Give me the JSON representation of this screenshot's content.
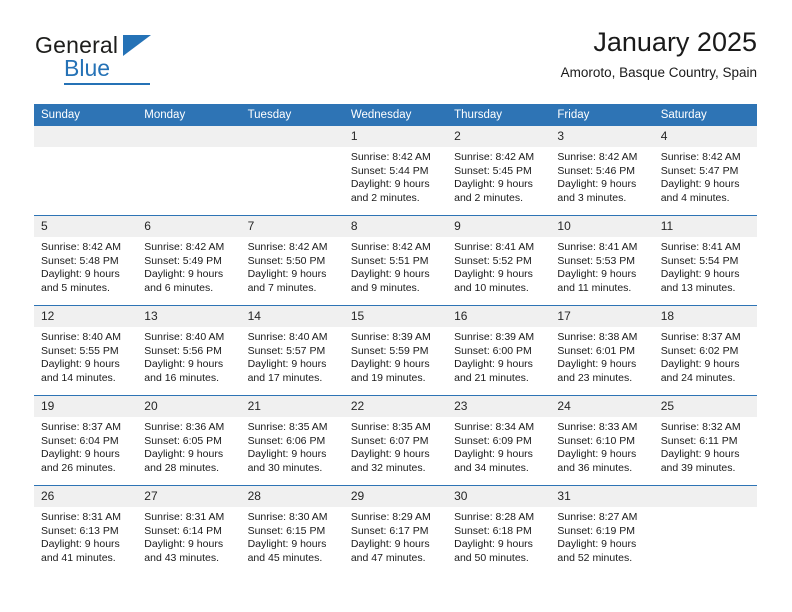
{
  "brand": {
    "name_primary": "General",
    "name_secondary": "Blue",
    "triangle_icon": "triangle-icon",
    "accent_color": "#2572b6"
  },
  "header": {
    "title": "January 2025",
    "subtitle": "Amoroto, Basque Country, Spain"
  },
  "colors": {
    "header_blue": "#2e74b5",
    "daynum_gray": "#f0f0f0",
    "text": "#1a1a1a"
  },
  "calendar": {
    "weekday_headers": [
      "Sunday",
      "Monday",
      "Tuesday",
      "Wednesday",
      "Thursday",
      "Friday",
      "Saturday"
    ],
    "weeks": [
      [
        {
          "day": "",
          "empty": true,
          "sunrise": "",
          "sunset": "",
          "daylight_line1": "",
          "daylight_line2": ""
        },
        {
          "day": "",
          "empty": true,
          "sunrise": "",
          "sunset": "",
          "daylight_line1": "",
          "daylight_line2": ""
        },
        {
          "day": "",
          "empty": true,
          "sunrise": "",
          "sunset": "",
          "daylight_line1": "",
          "daylight_line2": ""
        },
        {
          "day": "1",
          "empty": false,
          "sunrise": "Sunrise: 8:42 AM",
          "sunset": "Sunset: 5:44 PM",
          "daylight_line1": "Daylight: 9 hours",
          "daylight_line2": "and 2 minutes."
        },
        {
          "day": "2",
          "empty": false,
          "sunrise": "Sunrise: 8:42 AM",
          "sunset": "Sunset: 5:45 PM",
          "daylight_line1": "Daylight: 9 hours",
          "daylight_line2": "and 2 minutes."
        },
        {
          "day": "3",
          "empty": false,
          "sunrise": "Sunrise: 8:42 AM",
          "sunset": "Sunset: 5:46 PM",
          "daylight_line1": "Daylight: 9 hours",
          "daylight_line2": "and 3 minutes."
        },
        {
          "day": "4",
          "empty": false,
          "sunrise": "Sunrise: 8:42 AM",
          "sunset": "Sunset: 5:47 PM",
          "daylight_line1": "Daylight: 9 hours",
          "daylight_line2": "and 4 minutes."
        }
      ],
      [
        {
          "day": "5",
          "empty": false,
          "sunrise": "Sunrise: 8:42 AM",
          "sunset": "Sunset: 5:48 PM",
          "daylight_line1": "Daylight: 9 hours",
          "daylight_line2": "and 5 minutes."
        },
        {
          "day": "6",
          "empty": false,
          "sunrise": "Sunrise: 8:42 AM",
          "sunset": "Sunset: 5:49 PM",
          "daylight_line1": "Daylight: 9 hours",
          "daylight_line2": "and 6 minutes."
        },
        {
          "day": "7",
          "empty": false,
          "sunrise": "Sunrise: 8:42 AM",
          "sunset": "Sunset: 5:50 PM",
          "daylight_line1": "Daylight: 9 hours",
          "daylight_line2": "and 7 minutes."
        },
        {
          "day": "8",
          "empty": false,
          "sunrise": "Sunrise: 8:42 AM",
          "sunset": "Sunset: 5:51 PM",
          "daylight_line1": "Daylight: 9 hours",
          "daylight_line2": "and 9 minutes."
        },
        {
          "day": "9",
          "empty": false,
          "sunrise": "Sunrise: 8:41 AM",
          "sunset": "Sunset: 5:52 PM",
          "daylight_line1": "Daylight: 9 hours",
          "daylight_line2": "and 10 minutes."
        },
        {
          "day": "10",
          "empty": false,
          "sunrise": "Sunrise: 8:41 AM",
          "sunset": "Sunset: 5:53 PM",
          "daylight_line1": "Daylight: 9 hours",
          "daylight_line2": "and 11 minutes."
        },
        {
          "day": "11",
          "empty": false,
          "sunrise": "Sunrise: 8:41 AM",
          "sunset": "Sunset: 5:54 PM",
          "daylight_line1": "Daylight: 9 hours",
          "daylight_line2": "and 13 minutes."
        }
      ],
      [
        {
          "day": "12",
          "empty": false,
          "sunrise": "Sunrise: 8:40 AM",
          "sunset": "Sunset: 5:55 PM",
          "daylight_line1": "Daylight: 9 hours",
          "daylight_line2": "and 14 minutes."
        },
        {
          "day": "13",
          "empty": false,
          "sunrise": "Sunrise: 8:40 AM",
          "sunset": "Sunset: 5:56 PM",
          "daylight_line1": "Daylight: 9 hours",
          "daylight_line2": "and 16 minutes."
        },
        {
          "day": "14",
          "empty": false,
          "sunrise": "Sunrise: 8:40 AM",
          "sunset": "Sunset: 5:57 PM",
          "daylight_line1": "Daylight: 9 hours",
          "daylight_line2": "and 17 minutes."
        },
        {
          "day": "15",
          "empty": false,
          "sunrise": "Sunrise: 8:39 AM",
          "sunset": "Sunset: 5:59 PM",
          "daylight_line1": "Daylight: 9 hours",
          "daylight_line2": "and 19 minutes."
        },
        {
          "day": "16",
          "empty": false,
          "sunrise": "Sunrise: 8:39 AM",
          "sunset": "Sunset: 6:00 PM",
          "daylight_line1": "Daylight: 9 hours",
          "daylight_line2": "and 21 minutes."
        },
        {
          "day": "17",
          "empty": false,
          "sunrise": "Sunrise: 8:38 AM",
          "sunset": "Sunset: 6:01 PM",
          "daylight_line1": "Daylight: 9 hours",
          "daylight_line2": "and 23 minutes."
        },
        {
          "day": "18",
          "empty": false,
          "sunrise": "Sunrise: 8:37 AM",
          "sunset": "Sunset: 6:02 PM",
          "daylight_line1": "Daylight: 9 hours",
          "daylight_line2": "and 24 minutes."
        }
      ],
      [
        {
          "day": "19",
          "empty": false,
          "sunrise": "Sunrise: 8:37 AM",
          "sunset": "Sunset: 6:04 PM",
          "daylight_line1": "Daylight: 9 hours",
          "daylight_line2": "and 26 minutes."
        },
        {
          "day": "20",
          "empty": false,
          "sunrise": "Sunrise: 8:36 AM",
          "sunset": "Sunset: 6:05 PM",
          "daylight_line1": "Daylight: 9 hours",
          "daylight_line2": "and 28 minutes."
        },
        {
          "day": "21",
          "empty": false,
          "sunrise": "Sunrise: 8:35 AM",
          "sunset": "Sunset: 6:06 PM",
          "daylight_line1": "Daylight: 9 hours",
          "daylight_line2": "and 30 minutes."
        },
        {
          "day": "22",
          "empty": false,
          "sunrise": "Sunrise: 8:35 AM",
          "sunset": "Sunset: 6:07 PM",
          "daylight_line1": "Daylight: 9 hours",
          "daylight_line2": "and 32 minutes."
        },
        {
          "day": "23",
          "empty": false,
          "sunrise": "Sunrise: 8:34 AM",
          "sunset": "Sunset: 6:09 PM",
          "daylight_line1": "Daylight: 9 hours",
          "daylight_line2": "and 34 minutes."
        },
        {
          "day": "24",
          "empty": false,
          "sunrise": "Sunrise: 8:33 AM",
          "sunset": "Sunset: 6:10 PM",
          "daylight_line1": "Daylight: 9 hours",
          "daylight_line2": "and 36 minutes."
        },
        {
          "day": "25",
          "empty": false,
          "sunrise": "Sunrise: 8:32 AM",
          "sunset": "Sunset: 6:11 PM",
          "daylight_line1": "Daylight: 9 hours",
          "daylight_line2": "and 39 minutes."
        }
      ],
      [
        {
          "day": "26",
          "empty": false,
          "sunrise": "Sunrise: 8:31 AM",
          "sunset": "Sunset: 6:13 PM",
          "daylight_line1": "Daylight: 9 hours",
          "daylight_line2": "and 41 minutes."
        },
        {
          "day": "27",
          "empty": false,
          "sunrise": "Sunrise: 8:31 AM",
          "sunset": "Sunset: 6:14 PM",
          "daylight_line1": "Daylight: 9 hours",
          "daylight_line2": "and 43 minutes."
        },
        {
          "day": "28",
          "empty": false,
          "sunrise": "Sunrise: 8:30 AM",
          "sunset": "Sunset: 6:15 PM",
          "daylight_line1": "Daylight: 9 hours",
          "daylight_line2": "and 45 minutes."
        },
        {
          "day": "29",
          "empty": false,
          "sunrise": "Sunrise: 8:29 AM",
          "sunset": "Sunset: 6:17 PM",
          "daylight_line1": "Daylight: 9 hours",
          "daylight_line2": "and 47 minutes."
        },
        {
          "day": "30",
          "empty": false,
          "sunrise": "Sunrise: 8:28 AM",
          "sunset": "Sunset: 6:18 PM",
          "daylight_line1": "Daylight: 9 hours",
          "daylight_line2": "and 50 minutes."
        },
        {
          "day": "31",
          "empty": false,
          "sunrise": "Sunrise: 8:27 AM",
          "sunset": "Sunset: 6:19 PM",
          "daylight_line1": "Daylight: 9 hours",
          "daylight_line2": "and 52 minutes."
        },
        {
          "day": "",
          "empty": true,
          "sunrise": "",
          "sunset": "",
          "daylight_line1": "",
          "daylight_line2": ""
        }
      ]
    ]
  }
}
